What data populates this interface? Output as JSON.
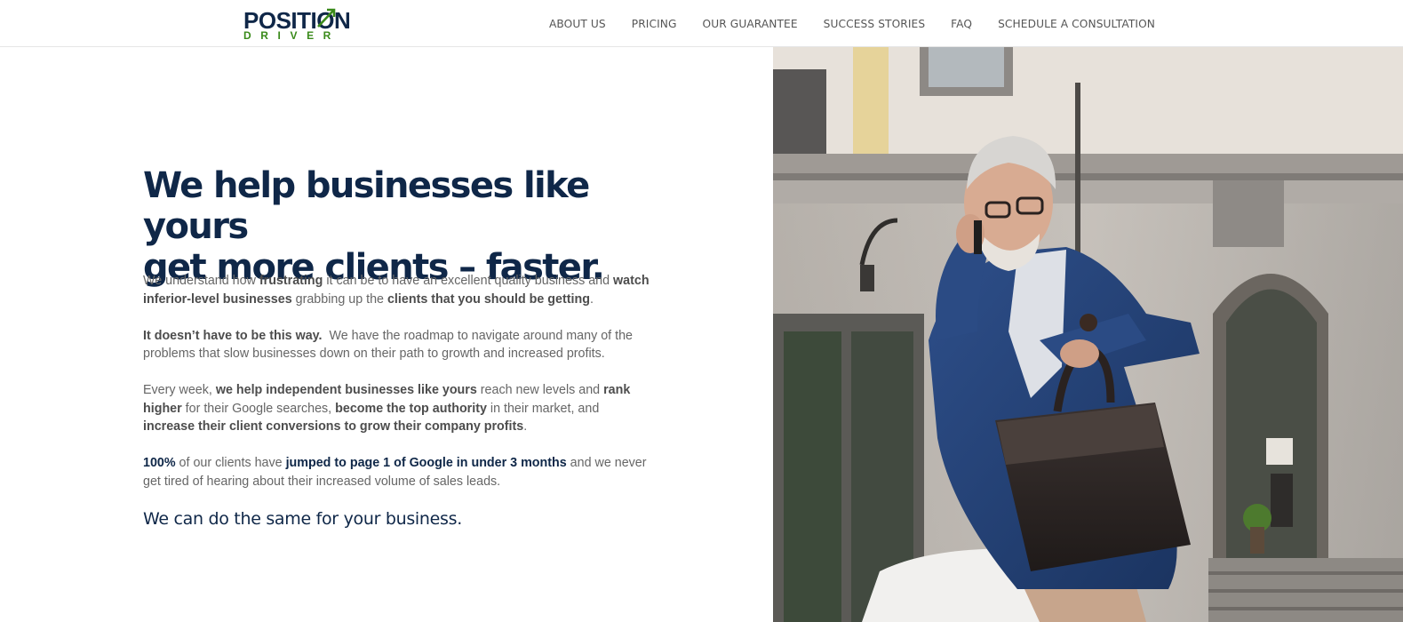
{
  "brand": {
    "logo_top": "POSITION",
    "logo_bottom": "DRIVER",
    "colors": {
      "navy": "#0f2748",
      "green": "#3a8a1a"
    }
  },
  "nav": {
    "items": [
      {
        "label": "ABOUT US"
      },
      {
        "label": "PRICING"
      },
      {
        "label": "OUR GUARANTEE"
      },
      {
        "label": "SUCCESS STORIES"
      },
      {
        "label": "FAQ"
      },
      {
        "label": "SCHEDULE A CONSULTATION"
      }
    ]
  },
  "hero": {
    "title_line1": "We help businesses like yours",
    "title_line2": "get more clients – faster.",
    "p1": {
      "a": "We understand how ",
      "b": "frustrating",
      "c": " it can be to have an excellent quality business and ",
      "d": "watch inferior-level businesses",
      "e": " grabbing up the ",
      "f": "clients that you should be getting",
      "g": "."
    },
    "p2": {
      "a": "It doesn’t have to be this way.",
      "b": "  We have the roadmap to navigate around many of the problems that slow businesses down on their path to growth and increased profits."
    },
    "p3": {
      "a": "Every week, ",
      "b": "we help independent businesses like yours",
      "c": " reach new levels and ",
      "d": "rank higher",
      "e": " for their Google searches, ",
      "f": "become the top authority",
      "g": " in their market, and ",
      "h": "increase their client conversions to grow their company profits",
      "i": "."
    },
    "p4": {
      "a": "100%",
      "b": " of our clients have ",
      "c": "jumped to page 1 of Google in under 3 months",
      "d": " and we never get tired of hearing about their increased volume of sales leads."
    },
    "tagline": "We can do the same for your business."
  },
  "image": {
    "subject": "businessman-on-phone-photo"
  }
}
